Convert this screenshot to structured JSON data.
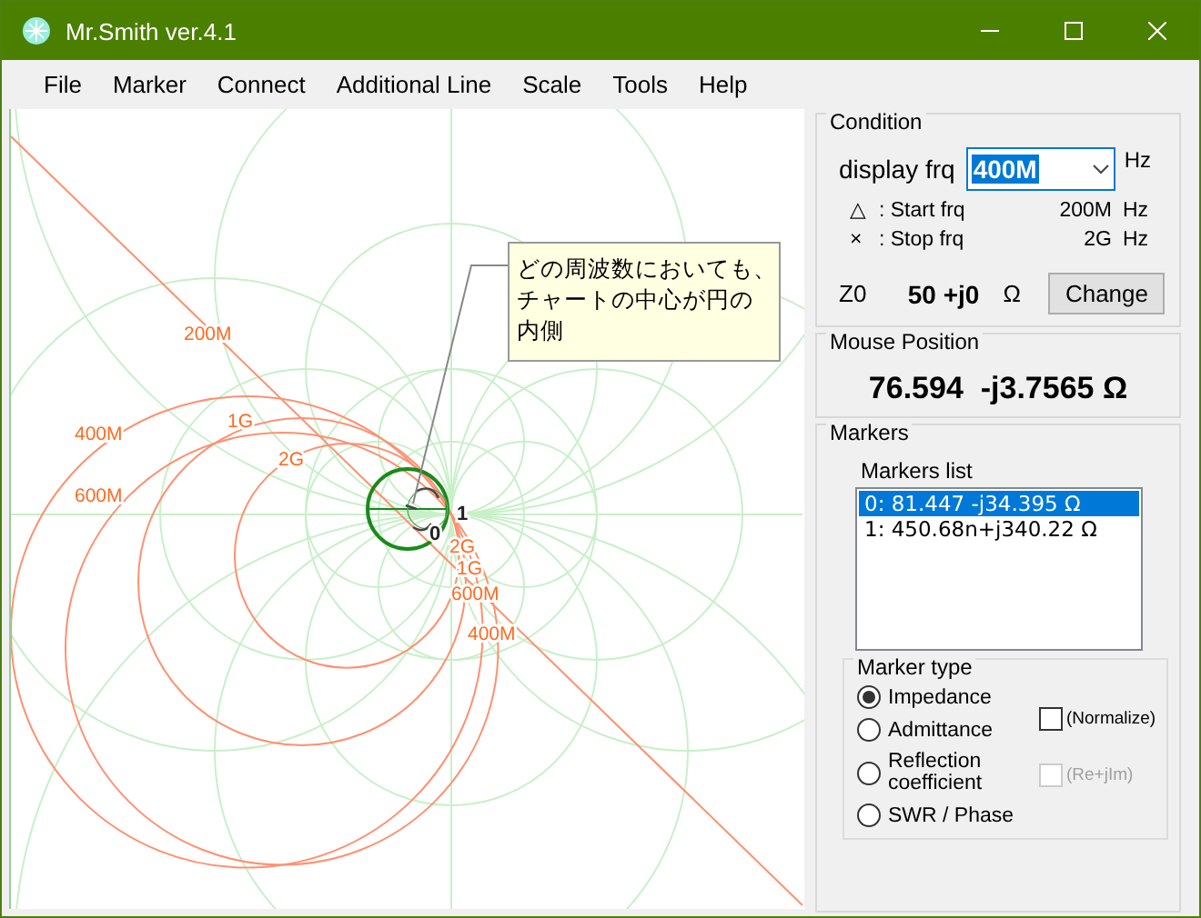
{
  "window": {
    "title": "Mr.Smith ver.4.1"
  },
  "menu": [
    {
      "label": "File"
    },
    {
      "label": "Marker"
    },
    {
      "label": "Connect"
    },
    {
      "label": "Additional Line"
    },
    {
      "label": "Scale"
    },
    {
      "label": "Tools"
    },
    {
      "label": "Help"
    }
  ],
  "chart": {
    "labels": [
      {
        "text": "200M",
        "kind": "freq"
      },
      {
        "text": "400M",
        "kind": "freq"
      },
      {
        "text": "600M",
        "kind": "freq"
      },
      {
        "text": "1G",
        "kind": "freq"
      },
      {
        "text": "2G",
        "kind": "freq"
      },
      {
        "text": "2G",
        "kind": "freq"
      },
      {
        "text": "1G",
        "kind": "freq"
      },
      {
        "text": "600M",
        "kind": "freq"
      },
      {
        "text": "400M",
        "kind": "freq"
      },
      {
        "text": "1",
        "kind": "axis"
      },
      {
        "text": "0",
        "kind": "axis"
      }
    ],
    "callout": {
      "lines": [
        "どの周波数においても、",
        "チャートの中心が円の",
        "内側"
      ]
    }
  },
  "condition": {
    "title": "Condition",
    "display_label": "display frq",
    "display_value": "400M",
    "display_unit": "Hz",
    "rows": [
      {
        "symbol": "△",
        "label": ": Start frq",
        "value": "200M",
        "unit": "Hz"
      },
      {
        "symbol": "×",
        "label": ": Stop frq",
        "value": "2G",
        "unit": "Hz"
      }
    ],
    "z0_label": "Z0",
    "z0_value": "50 +j0",
    "z0_unit": "Ω",
    "button": "Change"
  },
  "mouse_position": {
    "title": "Mouse Position",
    "value": "76.594  -j3.7565 Ω"
  },
  "markers": {
    "title": "Markers",
    "list_label": "Markers list",
    "items": [
      {
        "text": "0: 81.447 -j34.395 Ω",
        "selected": true
      },
      {
        "text": "1: 450.68n+j340.22 Ω",
        "selected": false
      }
    ],
    "type_title": "Marker type",
    "types": [
      {
        "label": "Impedance",
        "selected": true
      },
      {
        "label": "Admittance",
        "selected": false
      },
      {
        "label": "Reflection coefficient",
        "selected": false
      },
      {
        "label": "SWR / Phase",
        "selected": false
      }
    ],
    "options": [
      {
        "label": "(Normalize)",
        "checked": false,
        "disabled": false
      },
      {
        "label": "(Re+jIm)",
        "checked": false,
        "disabled": true
      }
    ]
  }
}
